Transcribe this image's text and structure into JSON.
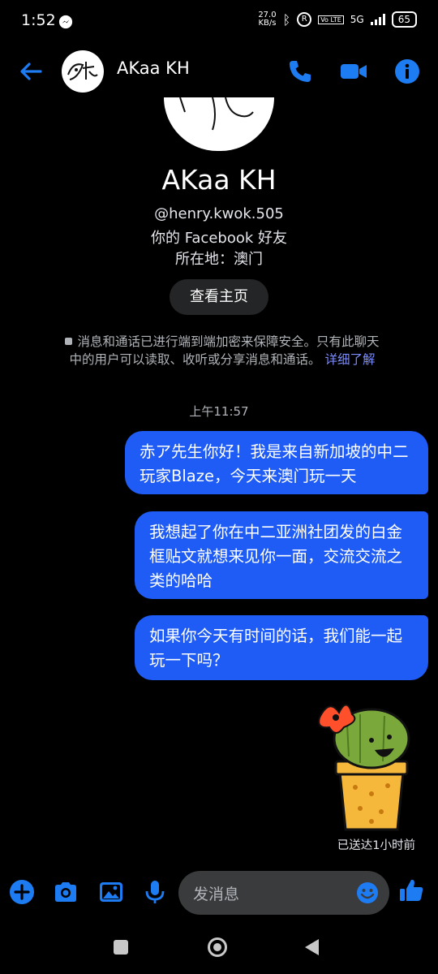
{
  "status_bar": {
    "time": "1:52",
    "net_speed_value": "27.0",
    "net_speed_unit": "KB/s",
    "network": "5G",
    "battery": "65"
  },
  "header": {
    "contact_name": "AKaa KH",
    "icons": [
      "back-arrow-icon",
      "phone-icon",
      "video-camera-icon",
      "info-icon"
    ],
    "accent_color": "#1e7cf2"
  },
  "profile": {
    "name": "AKaa KH",
    "username": "@henry.kwok.505",
    "relation": "你的 Facebook 好友",
    "location": "所在地：澳门",
    "view_button": "查看主页"
  },
  "encryption": {
    "text": "消息和通话已进行端到端加密来保障安全。只有此聊天中的用户可以读取、收听或分享消息和通话。",
    "link": "详细了解"
  },
  "conversation": {
    "timestamp": "上午11:57",
    "messages": [
      {
        "sender": "me",
        "text": "赤ア先生你好！我是来自新加坡的中二玩家Blaze，今天来澳门玩一天"
      },
      {
        "sender": "me",
        "text": "我想起了你在中二亚洲社团发的白金框贴文就想来见你一面，交流交流之类的哈哈"
      },
      {
        "sender": "me",
        "text": "如果你今天有时间的话，我们能一起玩一下吗？"
      }
    ],
    "sticker": "cactus-sticker",
    "delivery_status": "已送达1小时前"
  },
  "composer": {
    "placeholder": "发消息",
    "icons": [
      "plus-icon",
      "camera-icon",
      "image-icon",
      "microphone-icon",
      "emoji-icon",
      "thumbs-up-icon"
    ]
  }
}
